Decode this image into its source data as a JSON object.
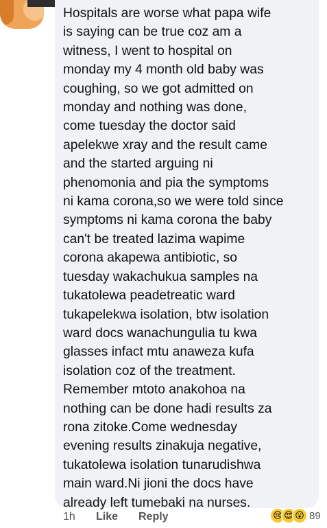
{
  "comment": {
    "text": "Hospitals are worse what papa wife\nis saying  can be true coz am a\nwitness, I went to hospital on\nmonday my 4 month old baby was\ncoughing, so we got admitted on\nmonday and nothing  was done,\ncome tuesday the doctor said\napelekwe xray and the result came\nand the started arguing ni\nphenomonia  and pia the symptoms\nni kama corona,so we were told since\nsymptoms ni kama corona the baby\ncan't be treated lazima wapime\ncorona akapewa antibiotic, so\ntuesday wakachukua samples na\ntukatolewa peadetreatic  ward\ntukapelekwa isolation, btw isolation\nward docs wanachungulia tu kwa\nglasses infact mtu anaweza kufa\nisolation coz of the treatment.\nRemember  mtoto anakohoa na\nnothing can be done hadi results za\nrona zitoke.Come wednesday\nevening results zinakuja negative,\ntukatolewa isolation tunarudishwa\nmain ward.Ni jioni the docs have\nalready left tumebaki na nurses."
  },
  "actions": {
    "time": "1h",
    "like": "Like",
    "reply": "Reply"
  },
  "reactions": {
    "icons": [
      "sad-face-icon",
      "love-face-icon",
      "wow-face-icon"
    ],
    "glyphs": [
      "😢",
      "😍",
      "😮"
    ],
    "count": "89"
  },
  "colors": {
    "bubble": "#f0f2f5",
    "text": "#111111",
    "meta": "#555555",
    "avatar": "#f0a457"
  }
}
